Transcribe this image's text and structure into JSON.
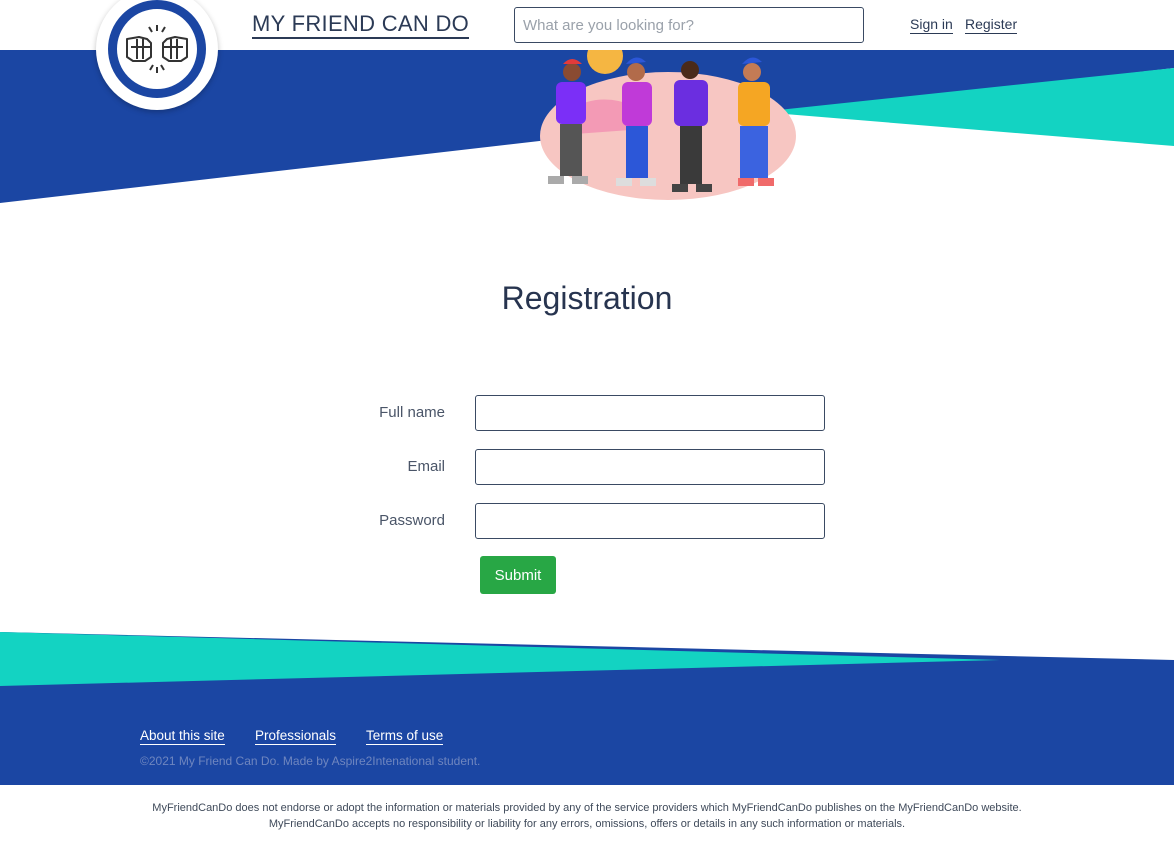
{
  "header": {
    "site_title": "MY FRIEND CAN DO",
    "search_placeholder": "What are you looking for?",
    "sign_in": "Sign in",
    "register": "Register"
  },
  "brand": {
    "primary_blue": "#1b46a3",
    "teal": "#13d3c2",
    "success_green": "#28a745"
  },
  "main": {
    "title": "Registration",
    "fields": [
      {
        "label": "Full name",
        "value": ""
      },
      {
        "label": "Email",
        "value": ""
      },
      {
        "label": "Password",
        "value": ""
      }
    ],
    "submit_label": "Submit"
  },
  "footer": {
    "links": [
      "About this site",
      "Professionals",
      "Terms of use"
    ],
    "copyright": "©2021 My Friend Can Do. Made by Aspire2Intenational student.",
    "disclaimer": "MyFriendCanDo does not endorse or adopt the information or materials provided by any of the service providers which MyFriendCanDo publishes on the MyFriendCanDo website. MyFriendCanDo accepts no responsibility or liability for any errors, omissions, offers or details in any such information or materials."
  }
}
